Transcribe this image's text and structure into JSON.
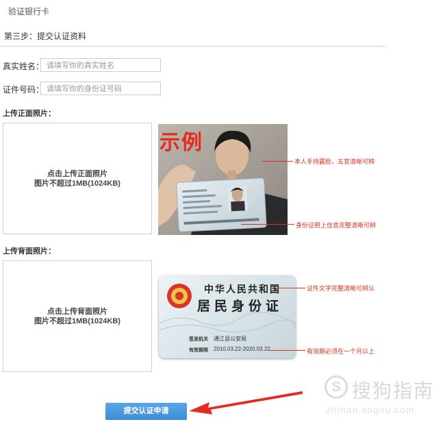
{
  "header": {
    "title": "验证银行卡"
  },
  "step": {
    "title": "第三步：提交认证资料"
  },
  "form": {
    "name_label": "真实姓名：",
    "name_placeholder": "请填写你的真实姓名",
    "id_label": "证件号码：",
    "id_placeholder": "请填写你的身份证号码"
  },
  "front": {
    "section_label": "上传正面照片：",
    "upload_line1": "点击上传正面照片",
    "upload_line2": "图片不超过1MB(1024KB)",
    "example_label": "示例",
    "annotation_face": "本人手持露脸，五官清晰可辨",
    "annotation_info": "身份证照上信息完整清晰可辨"
  },
  "back": {
    "section_label": "上传背面照片：",
    "upload_line1": "点击上传背面照片",
    "upload_line2": "图片不超过1MB(1024KB)",
    "card_title1": "中华人民共和国",
    "card_title2": "居民身份证",
    "issuer_label": "签发机关",
    "issuer_value": "通江县公安局",
    "valid_label": "有效期限",
    "valid_value": "2010.03.22-2020.03.22",
    "annotation_text": "证件文字完整清晰可辨认",
    "annotation_valid": "有效期必须在一个月以上"
  },
  "submit": {
    "label": "提交认证申请"
  },
  "watermark": {
    "text": "搜狗指南",
    "url": "zhinan.sogou.com"
  },
  "colors": {
    "accent": "#3e8dd6",
    "annotation": "#e03020"
  }
}
